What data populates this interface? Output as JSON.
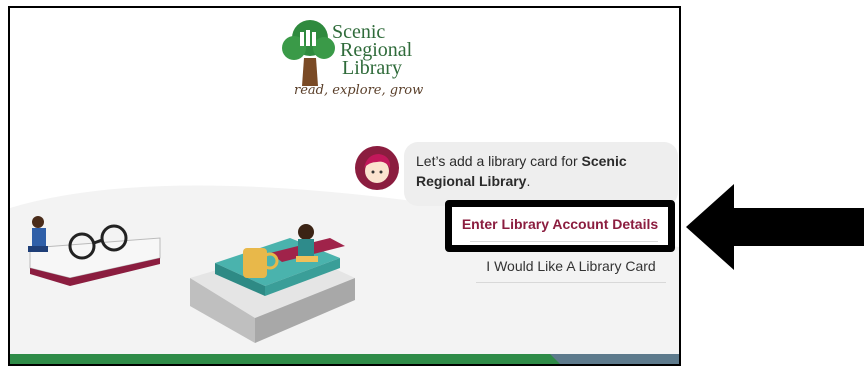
{
  "logo": {
    "line1": "Scenic",
    "line2": "Regional",
    "line3": "Library",
    "tagline": "read, explore, grow"
  },
  "chat": {
    "message_prefix": "Let’s add a library card for ",
    "message_bold": "Scenic Regional Library",
    "message_suffix": "."
  },
  "options": {
    "enter_details": "Enter Library Account Details",
    "request_card": "I Would Like A Library Card"
  },
  "colors": {
    "accent": "#8b1d3f",
    "footer_green": "#2e8b47",
    "footer_slate": "#5d7a8c"
  }
}
